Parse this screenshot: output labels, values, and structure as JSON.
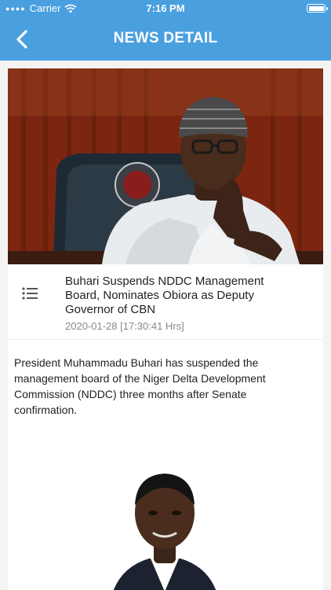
{
  "status_bar": {
    "carrier": "Carrier",
    "time": "7:16 PM"
  },
  "nav": {
    "title": "NEWS DETAIL",
    "back_icon": "chevron-left-icon"
  },
  "article": {
    "headline": "Buhari Suspends NDDC Management Board, Nominates Obiora as Deputy Governor of CBN",
    "date": "2020-01-28 [17:30:41 Hrs]",
    "body": "President Muhammadu Buhari has suspended the management board of the Niger Delta Development Commission (NDDC) three months after Senate confirmation.",
    "list_icon": "list-icon"
  },
  "colors": {
    "nav_bg": "#4a9fdf",
    "text": "#222222",
    "meta": "#888888"
  }
}
